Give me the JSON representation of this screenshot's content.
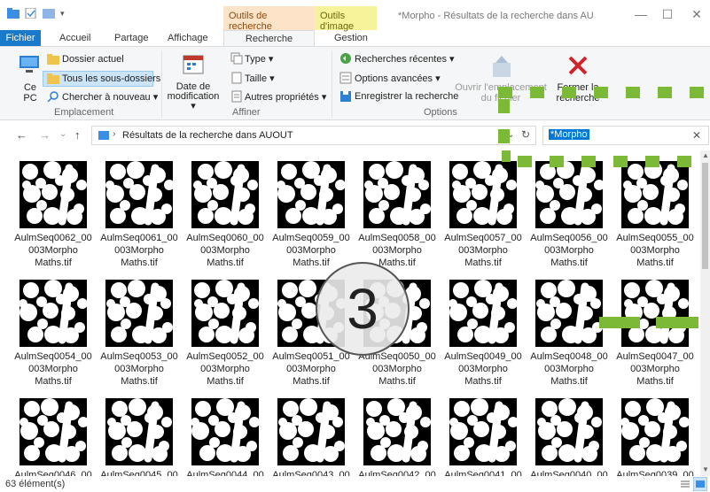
{
  "titlebar": {
    "ctx_search": "Outils de recherche",
    "ctx_image": "Outils d'image",
    "title": "*Morpho - Résultats de la recherche dans AU",
    "minimize": "—",
    "maximize": "☐",
    "close": "✕"
  },
  "tabs": {
    "file": "Fichier",
    "home": "Accueil",
    "share": "Partage",
    "view": "Affichage",
    "search": "Recherche",
    "manage": "Gestion",
    "help": "?"
  },
  "ribbon": {
    "location": {
      "pc": "Ce PC",
      "current_folder": "Dossier actuel",
      "all_subfolders": "Tous les sous-dossiers",
      "search_again": "Chercher à nouveau ▾",
      "label": "Emplacement"
    },
    "refine": {
      "date": "Date de modification ▾",
      "type": "Type ▾",
      "size": "Taille ▾",
      "other": "Autres propriétés ▾",
      "label": "Affiner"
    },
    "options": {
      "recent": "Recherches récentes ▾",
      "advanced": "Options avancées ▾",
      "save": "Enregistrer la recherche",
      "open_location": "Ouvrir l'emplacement du fichier",
      "close_search": "Fermer la recherche",
      "label": "Options"
    }
  },
  "address": {
    "back": "←",
    "forward": "→",
    "recent": "⌄",
    "up": "↑",
    "path": "Résultats de la recherche dans AUOUT",
    "refresh": "↻",
    "search_value": "*Morpho",
    "search_clear": "✕"
  },
  "files": [
    {
      "line1": "AulmSeq0062_00",
      "line2": "003Morpho",
      "line3": "Maths.tif"
    },
    {
      "line1": "AulmSeq0061_00",
      "line2": "003Morpho",
      "line3": "Maths.tif"
    },
    {
      "line1": "AulmSeq0060_00",
      "line2": "003Morpho",
      "line3": "Maths.tif"
    },
    {
      "line1": "AulmSeq0059_00",
      "line2": "003Morpho",
      "line3": "Maths.tif"
    },
    {
      "line1": "AulmSeq0058_00",
      "line2": "003Morpho",
      "line3": "Maths.tif"
    },
    {
      "line1": "AulmSeq0057_00",
      "line2": "003Morpho",
      "line3": "Maths.tif"
    },
    {
      "line1": "AulmSeq0056_00",
      "line2": "003Morpho",
      "line3": "Maths.tif"
    },
    {
      "line1": "AulmSeq0055_00",
      "line2": "003Morpho",
      "line3": "Maths.tif"
    },
    {
      "line1": "AulmSeq0054_00",
      "line2": "003Morpho",
      "line3": "Maths.tif"
    },
    {
      "line1": "AulmSeq0053_00",
      "line2": "003Morpho",
      "line3": "Maths.tif"
    },
    {
      "line1": "AulmSeq0052_00",
      "line2": "003Morpho",
      "line3": "Maths.tif"
    },
    {
      "line1": "AulmSeq0051_00",
      "line2": "003Morpho",
      "line3": "Maths.tif"
    },
    {
      "line1": "AulmSeq0050_00",
      "line2": "003Morpho",
      "line3": "Maths.tif"
    },
    {
      "line1": "AulmSeq0049_00",
      "line2": "003Morpho",
      "line3": "Maths.tif"
    },
    {
      "line1": "AulmSeq0048_00",
      "line2": "003Morpho",
      "line3": "Maths.tif"
    },
    {
      "line1": "AulmSeq0047_00",
      "line2": "003Morpho",
      "line3": "Maths.tif"
    },
    {
      "line1": "AulmSeq0046_00",
      "line2": "",
      "line3": ""
    },
    {
      "line1": "AulmSeq0045_00",
      "line2": "",
      "line3": ""
    },
    {
      "line1": "AulmSeq0044_00",
      "line2": "",
      "line3": ""
    },
    {
      "line1": "AulmSeq0043_00",
      "line2": "",
      "line3": ""
    },
    {
      "line1": "AulmSeq0042_00",
      "line2": "",
      "line3": ""
    },
    {
      "line1": "AulmSeq0041_00",
      "line2": "",
      "line3": ""
    },
    {
      "line1": "AulmSeq0040_00",
      "line2": "",
      "line3": ""
    },
    {
      "line1": "AulmSeq0039_00",
      "line2": "",
      "line3": ""
    }
  ],
  "status": {
    "count": "63 élément(s)"
  },
  "overlay": {
    "step_number": "3",
    "accent_color": "#7cb937"
  }
}
